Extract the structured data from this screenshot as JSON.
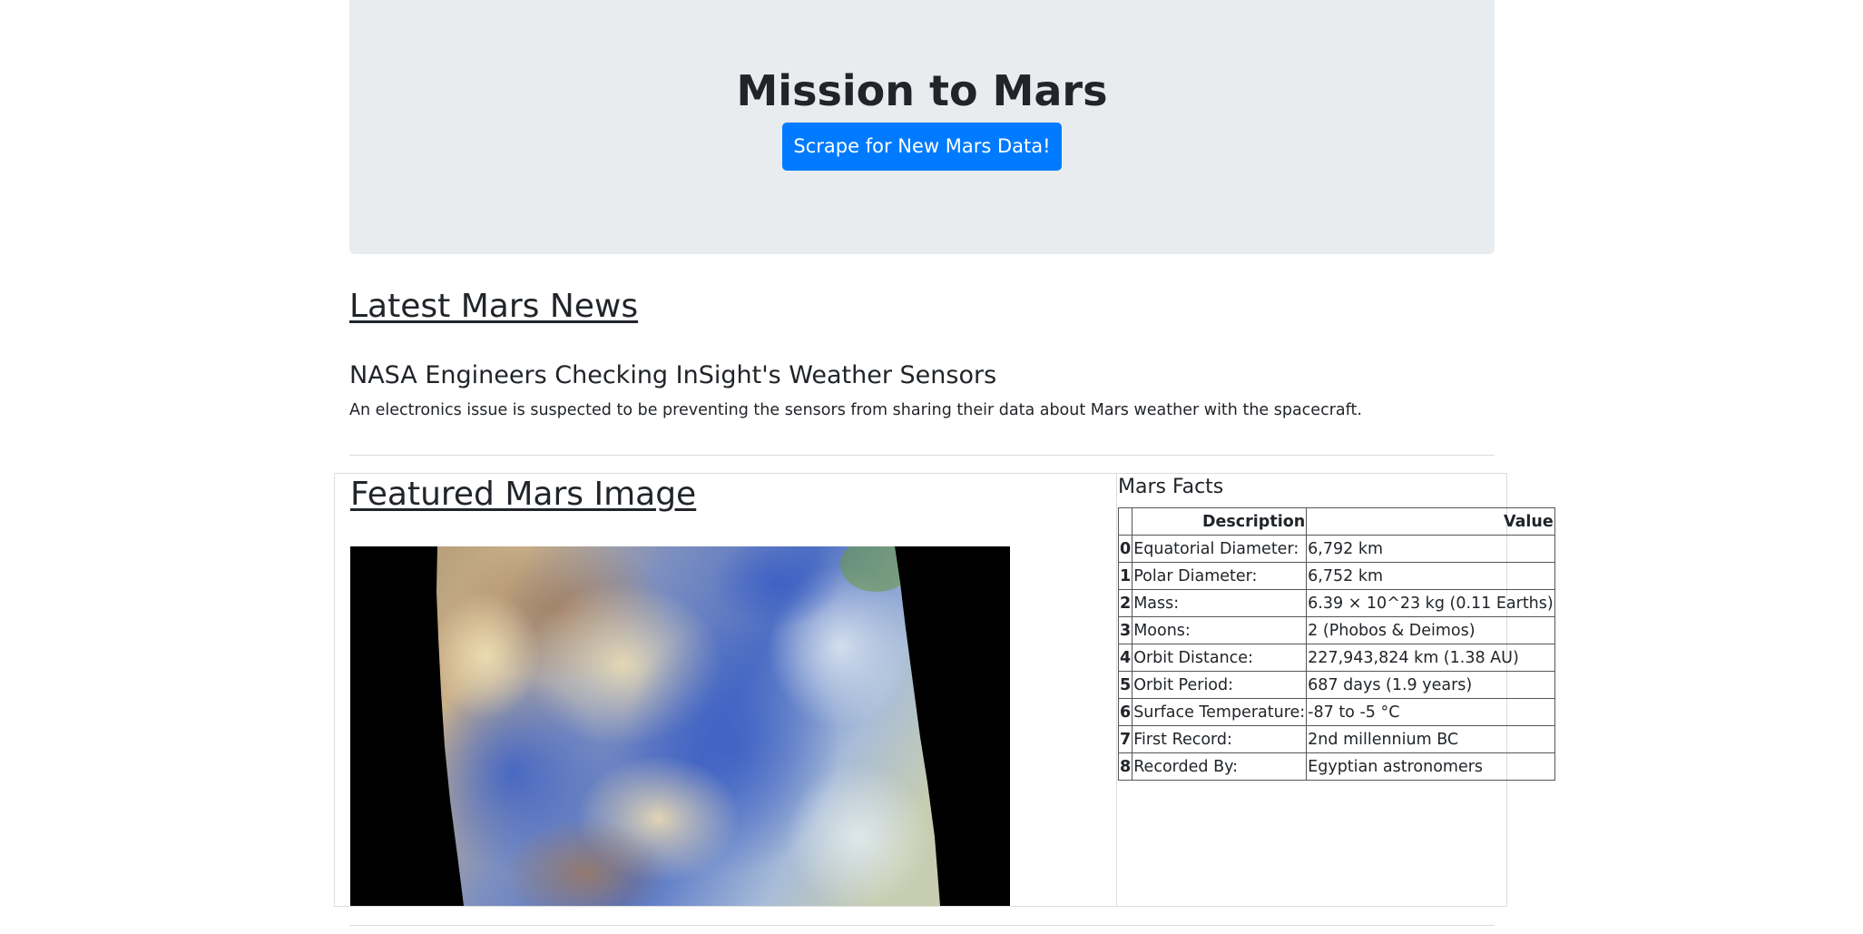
{
  "header": {
    "title": "Mission to Mars",
    "scrape_button": "Scrape for New Mars Data!"
  },
  "news": {
    "section_title": "Latest Mars News",
    "headline": "NASA Engineers Checking InSight's Weather Sensors",
    "paragraph": "An electronics issue is suspected to be preventing the sensors from sharing their data about Mars weather with the spacecraft."
  },
  "featured": {
    "section_title": "Featured Mars Image"
  },
  "facts": {
    "title": "Mars Facts",
    "columns": [
      "",
      "Description",
      "Value"
    ],
    "rows": [
      {
        "index": "0",
        "description": "Equatorial Diameter:",
        "value": "6,792 km"
      },
      {
        "index": "1",
        "description": "Polar Diameter:",
        "value": "6,752 km"
      },
      {
        "index": "2",
        "description": "Mass:",
        "value": "6.39 × 10^23 kg (0.11 Earths)"
      },
      {
        "index": "3",
        "description": "Moons:",
        "value": "2 (Phobos & Deimos)"
      },
      {
        "index": "4",
        "description": "Orbit Distance:",
        "value": "227,943,824 km (1.38 AU)"
      },
      {
        "index": "5",
        "description": "Orbit Period:",
        "value": "687 days (1.9 years)"
      },
      {
        "index": "6",
        "description": "Surface Temperature:",
        "value": "-87 to -5 °C"
      },
      {
        "index": "7",
        "description": "First Record:",
        "value": "2nd millennium BC"
      },
      {
        "index": "8",
        "description": "Recorded By:",
        "value": "Egyptian astronomers"
      }
    ]
  },
  "colors": {
    "jumbotron_bg": "#e9ecef",
    "primary_button": "#007bff",
    "text": "#212529"
  }
}
